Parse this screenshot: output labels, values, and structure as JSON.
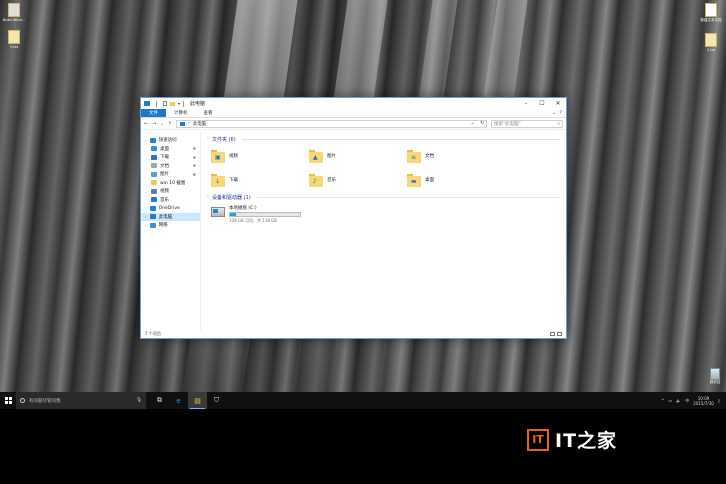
{
  "desktop": {
    "icons_left": [
      {
        "label": "Build.Wind..."
      },
      {
        "label": "1.txt"
      }
    ],
    "icons_right": [
      {
        "label": "新建文本文档"
      },
      {
        "label": "1.txt"
      }
    ],
    "recycle_bin": {
      "label": "回收站"
    }
  },
  "window": {
    "title": "此电脑",
    "ribbon_tabs": [
      "文件",
      "计算机",
      "查看"
    ],
    "address": "此电脑",
    "search_placeholder": "搜索\"此电脑\"",
    "sidebar": [
      {
        "label": "快速访问",
        "level": 0,
        "icon": "star-icon",
        "pinned": false
      },
      {
        "label": "桌面",
        "level": 1,
        "icon": "desktop-icon",
        "pinned": true
      },
      {
        "label": "下载",
        "level": 1,
        "icon": "download-icon",
        "pinned": true
      },
      {
        "label": "文档",
        "level": 1,
        "icon": "documents-icon",
        "pinned": true
      },
      {
        "label": "图片",
        "level": 1,
        "icon": "pictures-icon",
        "pinned": true
      },
      {
        "label": "win 10 截图",
        "level": 1,
        "icon": "folder-icon",
        "pinned": false
      },
      {
        "label": "视频",
        "level": 1,
        "icon": "videos-icon",
        "pinned": false
      },
      {
        "label": "音乐",
        "level": 1,
        "icon": "music-icon",
        "pinned": false
      },
      {
        "label": "OneDrive",
        "level": 0,
        "icon": "cloud-icon",
        "pinned": false
      },
      {
        "label": "此电脑",
        "level": 0,
        "icon": "computer-icon",
        "pinned": false,
        "selected": true
      },
      {
        "label": "网络",
        "level": 0,
        "icon": "network-icon",
        "pinned": false
      }
    ],
    "folders_group": {
      "title": "文件夹 (6)"
    },
    "folders": [
      {
        "label": "视频",
        "glyph": "▣",
        "icon": "videos-folder-icon"
      },
      {
        "label": "图片",
        "glyph": "▲",
        "icon": "pictures-folder-icon"
      },
      {
        "label": "文档",
        "glyph": "≡",
        "icon": "documents-folder-icon"
      },
      {
        "label": "下载",
        "glyph": "↓",
        "icon": "downloads-folder-icon"
      },
      {
        "label": "音乐",
        "glyph": "♪",
        "icon": "music-folder-icon"
      },
      {
        "label": "桌面",
        "glyph": "▬",
        "icon": "desktop-folder-icon"
      }
    ],
    "drives_group": {
      "title": "设备和驱动器 (1)"
    },
    "drive": {
      "name": "本地磁盘 (C:)",
      "free_text": "108 GB 可用，共 118 GB",
      "used_fraction": 0.085
    },
    "status": "7 个项目"
  },
  "taskbar": {
    "search_placeholder": "有问题尽管问我",
    "apps": [
      {
        "name": "task-view-icon",
        "glyph": "⧉",
        "active": false
      },
      {
        "name": "edge-icon",
        "glyph": "e",
        "active": false
      },
      {
        "name": "file-explorer-icon",
        "glyph": "▤",
        "active": true
      },
      {
        "name": "store-icon",
        "glyph": "⛉",
        "active": false
      }
    ],
    "time": "10:09",
    "date": "2015/7/30"
  },
  "watermark": {
    "text_a": "IT之家",
    "logo": "IT"
  }
}
